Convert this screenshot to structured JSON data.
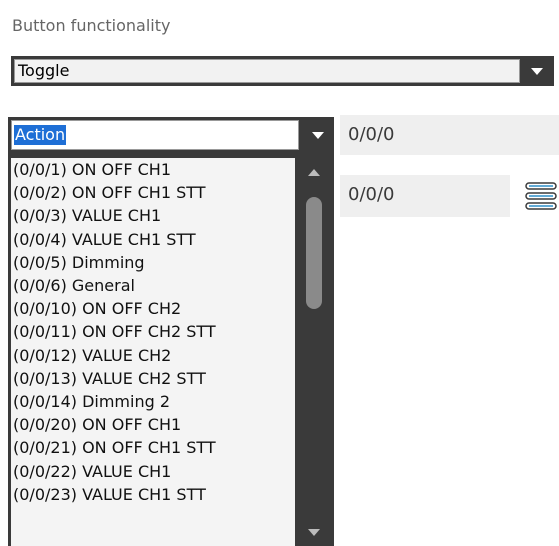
{
  "section": {
    "title": "Button functionality"
  },
  "function_select": {
    "value": "Toggle",
    "icon": "chevron-down-icon"
  },
  "action_dropdown": {
    "selected": "Action",
    "icon": "chevron-down-icon",
    "options": [
      "(0/0/1) ON OFF CH1",
      "(0/0/2) ON OFF CH1 STT",
      "(0/0/3) VALUE CH1",
      "(0/0/4) VALUE CH1 STT",
      "(0/0/5) Dimming",
      "(0/0/6) General",
      "(0/0/10) ON OFF CH2",
      "(0/0/11) ON OFF CH2 STT",
      "(0/0/12) VALUE CH2",
      "(0/0/13) VALUE CH2 STT",
      "(0/0/14) Dimming 2",
      "(0/0/20) ON OFF CH1",
      "(0/0/21) ON OFF CH1 STT",
      "(0/0/22) VALUE CH1",
      "(0/0/23) VALUE CH1 STT"
    ]
  },
  "address_fields": [
    {
      "value": "0/0/0"
    },
    {
      "value": "0/0/0"
    }
  ],
  "list_icon": "list-icon",
  "colors": {
    "dark_frame": "#3a3a3a",
    "selection": "#1e6fd6",
    "field_bg": "#efefef",
    "icon_accent": "#2f8fc9"
  }
}
